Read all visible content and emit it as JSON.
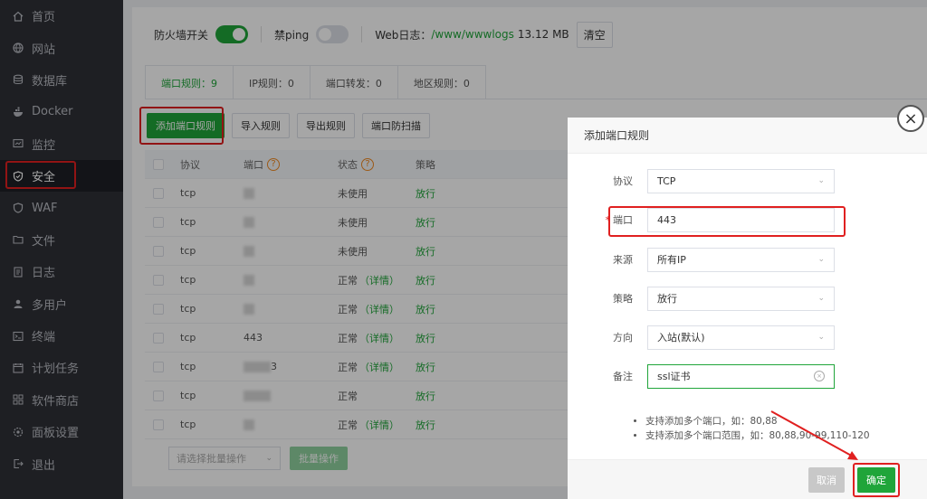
{
  "sidebar": {
    "items": [
      {
        "label": "首页",
        "icon": "home-icon"
      },
      {
        "label": "网站",
        "icon": "globe-icon"
      },
      {
        "label": "数据库",
        "icon": "database-icon"
      },
      {
        "label": "Docker",
        "icon": "docker-icon"
      },
      {
        "label": "监控",
        "icon": "monitor-icon"
      },
      {
        "label": "安全",
        "icon": "shield-icon",
        "active": true
      },
      {
        "label": "WAF",
        "icon": "waf-shield-icon"
      },
      {
        "label": "文件",
        "icon": "folder-icon"
      },
      {
        "label": "日志",
        "icon": "log-icon"
      },
      {
        "label": "多用户",
        "icon": "users-icon"
      },
      {
        "label": "终端",
        "icon": "terminal-icon"
      },
      {
        "label": "计划任务",
        "icon": "schedule-icon"
      },
      {
        "label": "软件商店",
        "icon": "store-icon"
      },
      {
        "label": "面板设置",
        "icon": "settings-icon"
      },
      {
        "label": "退出",
        "icon": "logout-icon"
      }
    ]
  },
  "topbar": {
    "firewall_label": "防火墙开关",
    "ping_label": "禁ping",
    "weblog_label": "Web日志：",
    "weblog_path": "/www/wwwlogs",
    "weblog_size": "13.12 MB",
    "clear_label": "清空"
  },
  "tabs": [
    "端口规则：9",
    "IP规则：0",
    "端口转发：0",
    "地区规则：0"
  ],
  "actions": {
    "add": "添加端口规则",
    "import": "导入规则",
    "export": "导出规则",
    "scan": "端口防扫描"
  },
  "table": {
    "headers": {
      "protocol": "协议",
      "port": "端口",
      "status": "状态",
      "policy": "策略"
    },
    "rows": [
      {
        "protocol": "tcp",
        "port": "",
        "status": "未使用",
        "detail": "",
        "policy": "放行"
      },
      {
        "protocol": "tcp",
        "port": "",
        "status": "未使用",
        "detail": "",
        "policy": "放行"
      },
      {
        "protocol": "tcp",
        "port": "",
        "status": "未使用",
        "detail": "",
        "policy": "放行"
      },
      {
        "protocol": "tcp",
        "port": "",
        "status": "正常",
        "detail": "（详情）",
        "policy": "放行"
      },
      {
        "protocol": "tcp",
        "port": "",
        "status": "正常",
        "detail": "（详情）",
        "policy": "放行"
      },
      {
        "protocol": "tcp",
        "port": "443",
        "status": "正常",
        "detail": "（详情）",
        "policy": "放行"
      },
      {
        "protocol": "tcp",
        "port": "3",
        "status": "正常",
        "detail": "（详情）",
        "policy": "放行"
      },
      {
        "protocol": "tcp",
        "port": "",
        "status": "正常",
        "detail": "",
        "policy": "放行"
      },
      {
        "protocol": "tcp",
        "port": "",
        "status": "正常",
        "detail": "（详情）",
        "policy": "放行"
      }
    ]
  },
  "batch": {
    "select_placeholder": "请选择批量操作",
    "button": "批量操作"
  },
  "modal": {
    "title": "添加端口规则",
    "fields": {
      "protocol_label": "协议",
      "protocol_value": "TCP",
      "port_label": "端口",
      "port_value": "443",
      "source_label": "来源",
      "source_value": "所有IP",
      "policy_label": "策略",
      "policy_value": "放行",
      "direction_label": "方向",
      "direction_value": "入站(默认)",
      "note_label": "备注",
      "note_value": "ssl证书"
    },
    "tips": [
      "支持添加多个端口，如：80,88",
      "支持添加多个端口范围，如：80,88,90-99,110-120"
    ],
    "cancel": "取消",
    "ok": "确定"
  },
  "colors": {
    "accent": "#20a53a",
    "highlight": "#e02020",
    "sidebar": "#2f3137"
  }
}
